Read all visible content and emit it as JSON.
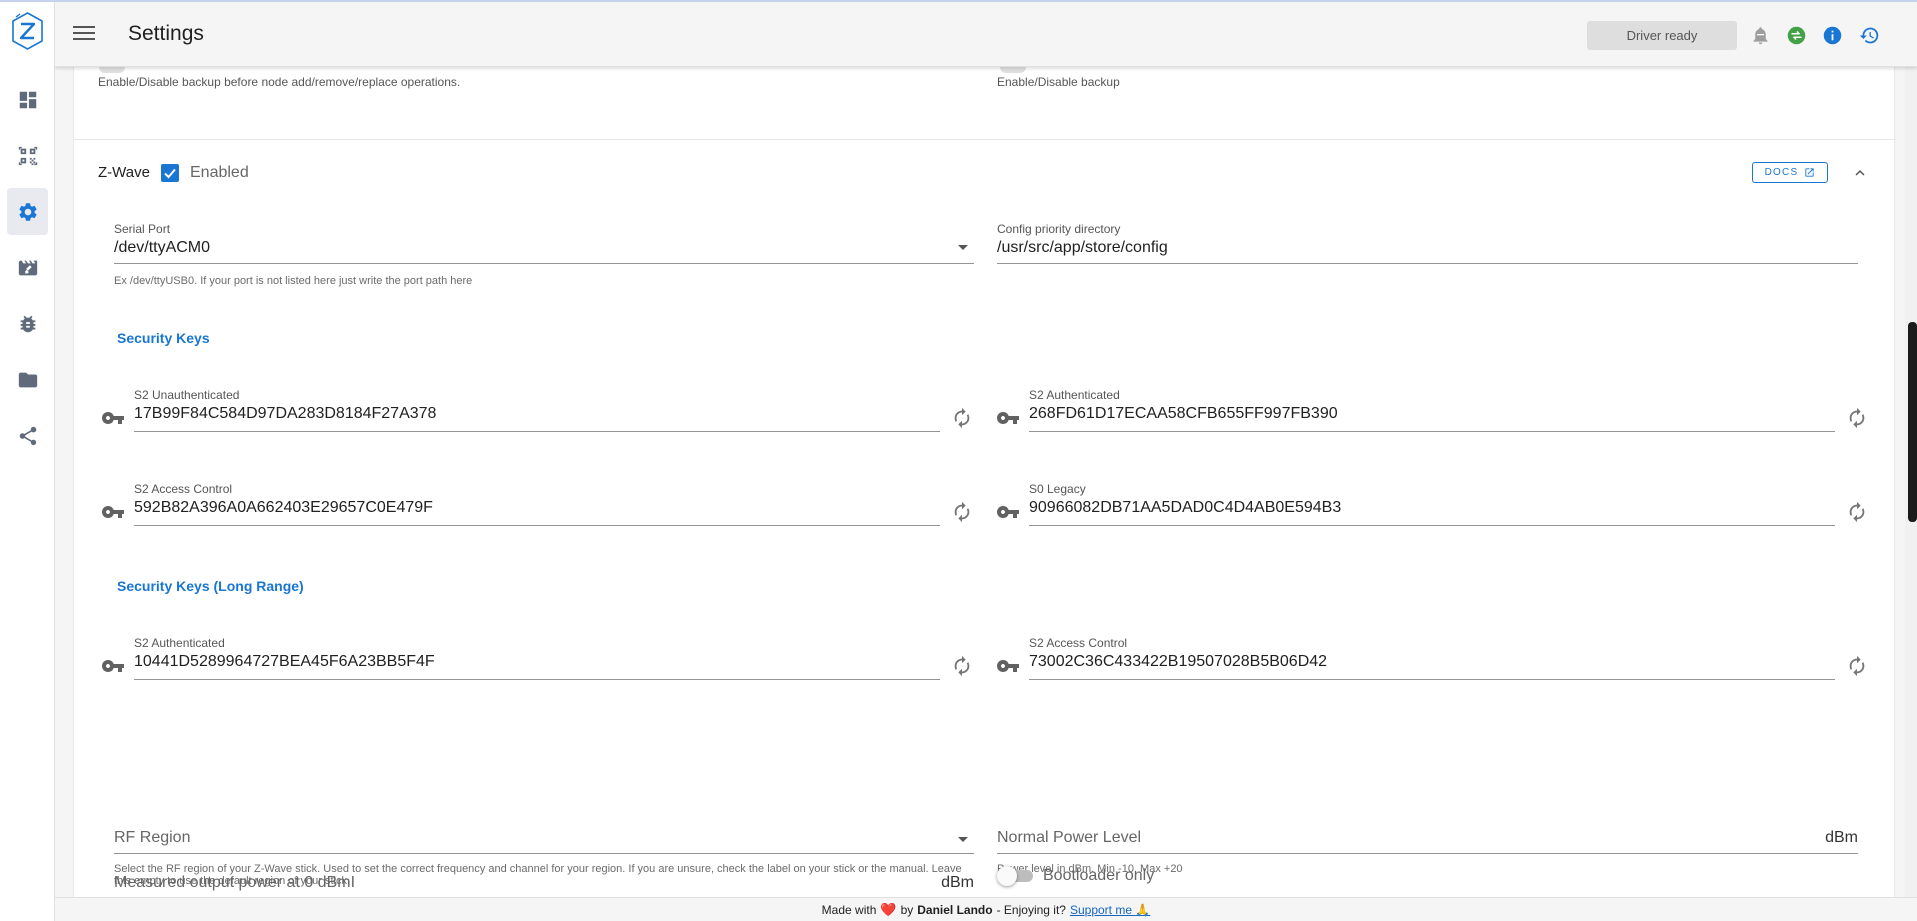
{
  "app": {
    "title": "Settings",
    "driver_status": "Driver ready"
  },
  "sidebar": {
    "active": "settings",
    "items": [
      {
        "id": "dashboard",
        "icon": "dashboard-icon"
      },
      {
        "id": "smart-start",
        "icon": "qrcode-scan-icon"
      },
      {
        "id": "settings",
        "icon": "gear-icon"
      },
      {
        "id": "scenes",
        "icon": "movie-edit-icon"
      },
      {
        "id": "debug",
        "icon": "bug-icon"
      },
      {
        "id": "store",
        "icon": "folder-icon"
      },
      {
        "id": "network-graph",
        "icon": "share-icon"
      }
    ]
  },
  "appbar_icons": {
    "bell": {
      "icon": "bell-off-icon",
      "color": "#9e9e9e"
    },
    "connection": {
      "icon": "swap-icon",
      "color": "#43a047"
    },
    "info": {
      "icon": "info-icon",
      "color": "#1976d2"
    },
    "history": {
      "icon": "history-icon",
      "color": "#1976d2"
    }
  },
  "backup": {
    "left_hint": "Enable/Disable backup before node add/remove/replace operations.",
    "right_hint": "Enable/Disable backup"
  },
  "zwave": {
    "label": "Z-Wave",
    "enabled_label": "Enabled",
    "enabled": true,
    "docs_label": "DOCS",
    "serial_port": {
      "label": "Serial Port",
      "value": "/dev/ttyACM0",
      "hint": "Ex /dev/ttyUSB0. If your port is not listed here just write the port path here"
    },
    "config_dir": {
      "label": "Config priority directory",
      "value": "/usr/src/app/store/config"
    },
    "security_keys_title": "Security Keys",
    "s2_unauth": {
      "label": "S2 Unauthenticated",
      "value": "17B99F84C584D97DA283D8184F27A378"
    },
    "s2_auth": {
      "label": "S2 Authenticated",
      "value": "268FD61D17ECAA58CFB655FF997FB390"
    },
    "s2_access": {
      "label": "S2 Access Control",
      "value": "592B82A396A0A662403E29657C0E479F"
    },
    "s0_legacy": {
      "label": "S0 Legacy",
      "value": "90966082DB71AA5DAD0C4D4AB0E594B3"
    },
    "lr_keys_title": "Security Keys (Long Range)",
    "lr_s2_auth": {
      "label": "S2 Authenticated",
      "value": "10441D5289964727BEA45F6A23BB5F4F"
    },
    "lr_s2_access": {
      "label": "S2 Access Control",
      "value": "73002C36C433422B19507028B5B06D42"
    },
    "rf_region": {
      "placeholder": "RF Region",
      "hint": "Select the RF region of your Z-Wave stick. Used to set the correct frequency and channel for your region. If you are unsure, check the label on your stick or the manual. Leave this empty to use the default region of your stick."
    },
    "power_level": {
      "placeholder": "Normal Power Level",
      "suffix": "dBm",
      "hint": "Power level in dBm. Min -10, Max +20"
    },
    "measured_power": {
      "placeholder": "Measured output power at 0 dBmI",
      "suffix": "dBm"
    },
    "bootloader": {
      "label": "Bootloader only",
      "on": false
    }
  },
  "footer": {
    "made_with": "Made with",
    "by": "by",
    "author": "Daniel Lando",
    "enjoying": "- Enjoying it?",
    "support": "Support me",
    "support_emoji": "🙏"
  }
}
